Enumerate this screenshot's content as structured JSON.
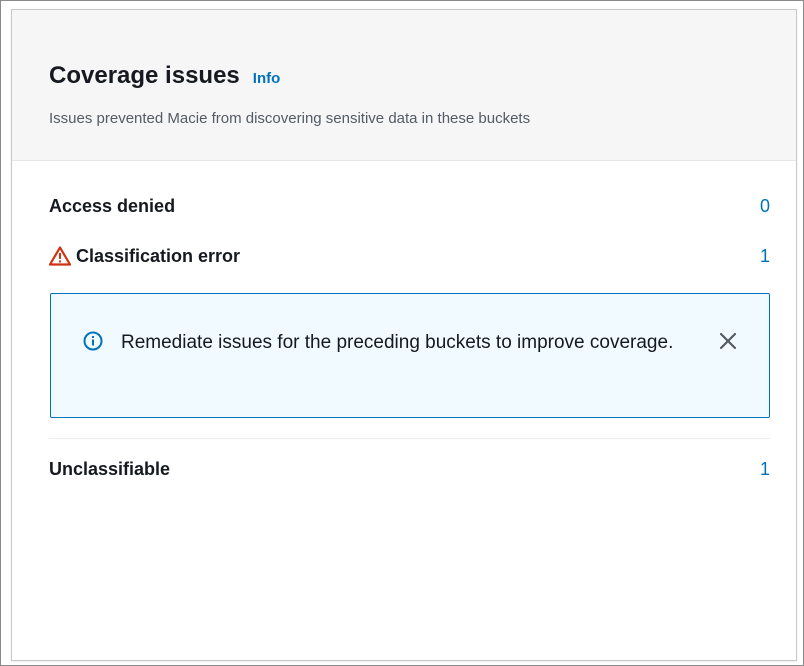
{
  "header": {
    "title": "Coverage issues",
    "info_label": "Info",
    "subtitle": "Issues prevented Macie from discovering sensitive data in these buckets"
  },
  "rows": [
    {
      "label": "Access denied",
      "count": "0",
      "icon": null
    },
    {
      "label": "Classification error",
      "count": "1",
      "icon": "warning-icon"
    },
    {
      "label": "Unclassifiable",
      "count": "1",
      "icon": null
    }
  ],
  "alert": {
    "icon": "info-icon",
    "text": "Remediate issues for the preceding buckets to improve coverage.",
    "close_icon": "close-icon"
  },
  "colors": {
    "link": "#0073bb",
    "warning": "#d13212",
    "alert_border": "#0073bb",
    "alert_bg": "#f1faff",
    "header_bg": "#f6f6f6"
  }
}
